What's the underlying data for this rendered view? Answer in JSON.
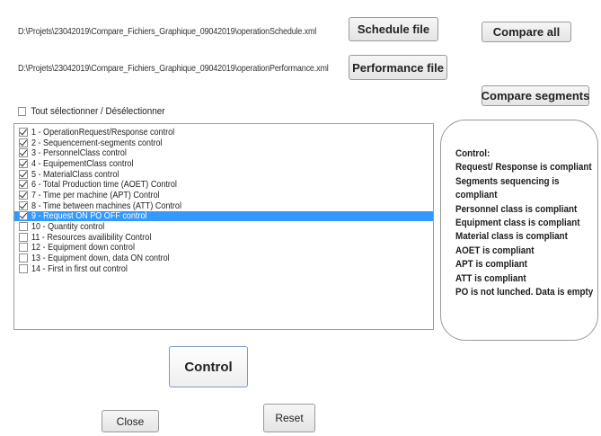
{
  "files": {
    "schedule_path": "D:\\Projets\\23042019\\Compare_Fichiers_Graphique_09042019\\operationSchedule.xml",
    "performance_path": "D:\\Projets\\23042019\\Compare_Fichiers_Graphique_09042019\\operationPerformance.xml",
    "schedule_button": "Schedule file",
    "performance_button": "Performance file"
  },
  "compare": {
    "all_button": "Compare all",
    "segments_button": "Compare segments"
  },
  "select_all": {
    "label": "Tout sélectionner / Désélectionner",
    "checked": false
  },
  "controls": [
    {
      "label": "1 - OperationRequest/Response control",
      "checked": true,
      "selected": false
    },
    {
      "label": "2 - Sequencement-segments control",
      "checked": true,
      "selected": false
    },
    {
      "label": "3 - PersonnelClass control",
      "checked": true,
      "selected": false
    },
    {
      "label": "4 - EquipementClass control",
      "checked": true,
      "selected": false
    },
    {
      "label": "5 - MaterialClass control",
      "checked": true,
      "selected": false
    },
    {
      "label": "6 - Total Production time (AOET) Control",
      "checked": true,
      "selected": false
    },
    {
      "label": "7 - Time per machine (APT) Control",
      "checked": true,
      "selected": false
    },
    {
      "label": "8 - Time between machines (ATT) Control",
      "checked": true,
      "selected": false
    },
    {
      "label": "9 - Request ON PO OFF control",
      "checked": true,
      "selected": true
    },
    {
      "label": "10 - Quantity control",
      "checked": false,
      "selected": false
    },
    {
      "label": "11 - Resources availibility Control",
      "checked": false,
      "selected": false
    },
    {
      "label": "12 - Equipment down control",
      "checked": false,
      "selected": false
    },
    {
      "label": "13 - Equipment down, data ON control",
      "checked": false,
      "selected": false
    },
    {
      "label": "14 - First in first out control",
      "checked": false,
      "selected": false
    }
  ],
  "result": {
    "lines": [
      "Control:",
      " Request/ Response is compliant",
      "Segments sequencing is",
      "compliant",
      "Personnel class is compliant",
      "Equipment class is compliant",
      "Material class is compliant",
      "AOET is compliant",
      "APT is compliant",
      "ATT is compliant",
      "PO is not lunched. Data is empty"
    ]
  },
  "actions": {
    "control_button": "Control",
    "close_button": "Close",
    "reset_button": "Reset"
  },
  "colors": {
    "selection": "#3399ff",
    "control_border": "#7b9bc1"
  }
}
